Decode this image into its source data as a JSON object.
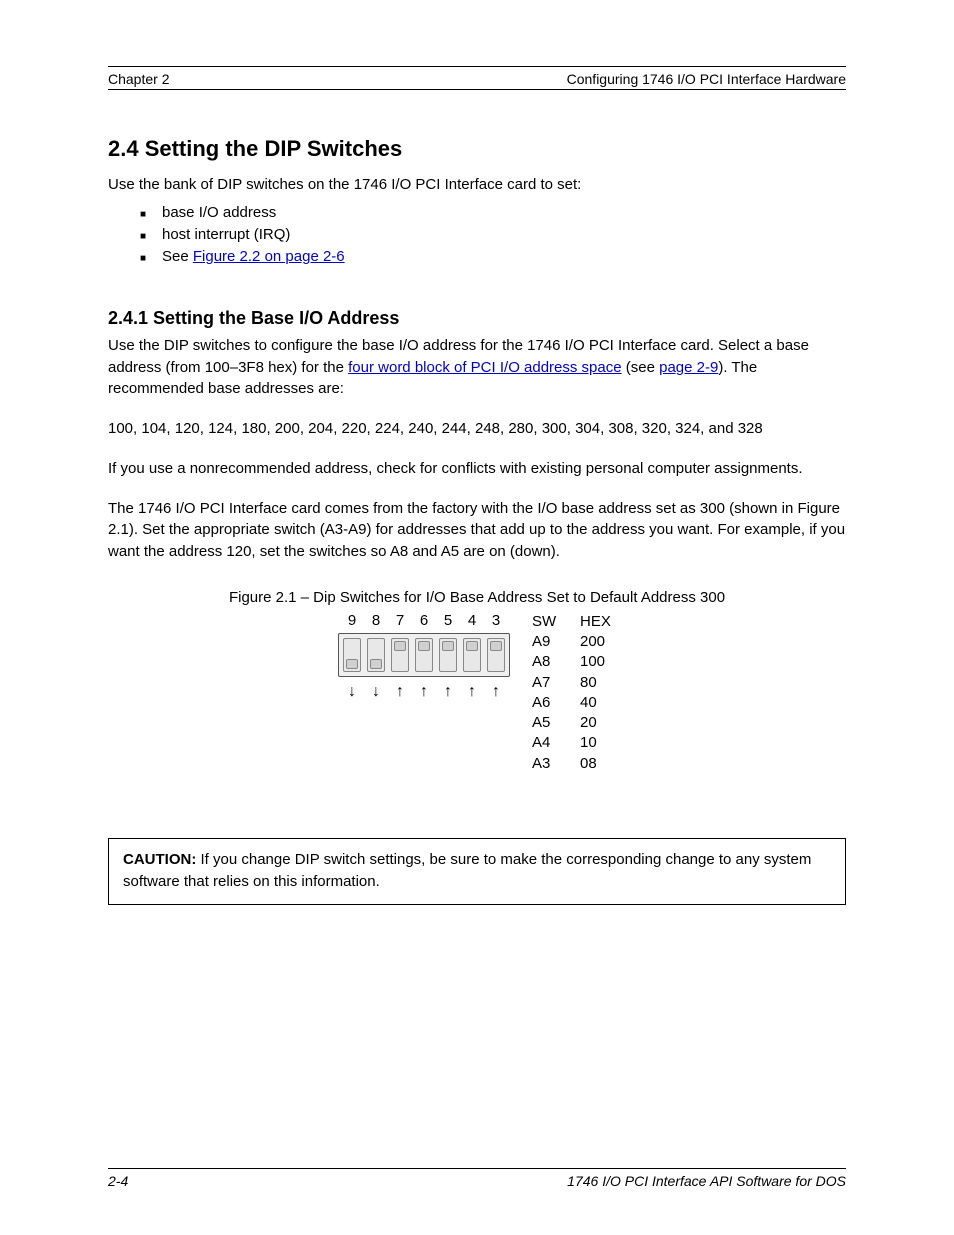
{
  "header": {
    "left": "Chapter 2",
    "right": "Configuring 1746 I/O PCI Interface Hardware"
  },
  "section2_4": {
    "heading": "2.4 Setting the DIP Switches",
    "intro": "Use the bank of DIP switches on the 1746 I/O PCI Interface card to set:",
    "bullets": [
      {
        "text": "base I/O address"
      },
      {
        "text": "host interrupt (IRQ)"
      },
      {
        "text_pre": "See ",
        "link": "Figure 2.2 on page 2-6",
        "text_post": ""
      }
    ]
  },
  "section2_4_1": {
    "heading": "2.4.1 Setting the Base I/O Address",
    "para1_pre": "Use the DIP switches to configure the base I/O address for the 1746 I/O PCI Interface card. Select a base address (from 100–3F8 hex) for the ",
    "para1_link1": "four word block of PCI I/O address space",
    "para1_mid": " (see ",
    "para1_link2": "page 2-9",
    "para1_post": "). The recommended base addresses are:",
    "addresses": "100, 104, 120, 124, 180, 200, 204, 220, 224, 240, 244, 248, 280, 300, 304, 308, 320, 324, and 328",
    "para2": "If you use a nonrecommended address, check for conflicts with existing personal computer assignments.",
    "para3": "The 1746 I/O PCI Interface card comes from the factory with the I/O base address set as 300 (shown in Figure 2.1). Set the appropriate switch (A3-A9) for addresses that add up to the address you want. For example, if you want the address 120, set the switches so A8 and A5 are on (down)."
  },
  "figure": {
    "caption": "Figure 2.1 – Dip Switches for I/O Base Address Set to Default Address 300",
    "switch_labels": [
      "9",
      "8",
      "7",
      "6",
      "5",
      "4",
      "3"
    ],
    "switch_states": [
      "down",
      "down",
      "up",
      "up",
      "up",
      "up",
      "up"
    ],
    "arrows": [
      "↓",
      "↓",
      "↑",
      "↑",
      "↑",
      "↑",
      "↑"
    ],
    "hex_header": {
      "col1": "SW",
      "col2": "HEX"
    },
    "hex_rows": [
      {
        "sw": "A9",
        "hex": "200"
      },
      {
        "sw": "A8",
        "hex": "100"
      },
      {
        "sw": "A7",
        "hex": "80"
      },
      {
        "sw": "A6",
        "hex": "40"
      },
      {
        "sw": "A5",
        "hex": "20"
      },
      {
        "sw": "A4",
        "hex": "10"
      },
      {
        "sw": "A3",
        "hex": "08"
      }
    ]
  },
  "caution": {
    "label": "CAUTION:",
    "text": " If you change DIP switch settings, be sure to make the corresponding change to any system software that relies on this information."
  },
  "footer": {
    "left": "2-4",
    "right": "1746 I/O PCI Interface API Software for DOS"
  }
}
